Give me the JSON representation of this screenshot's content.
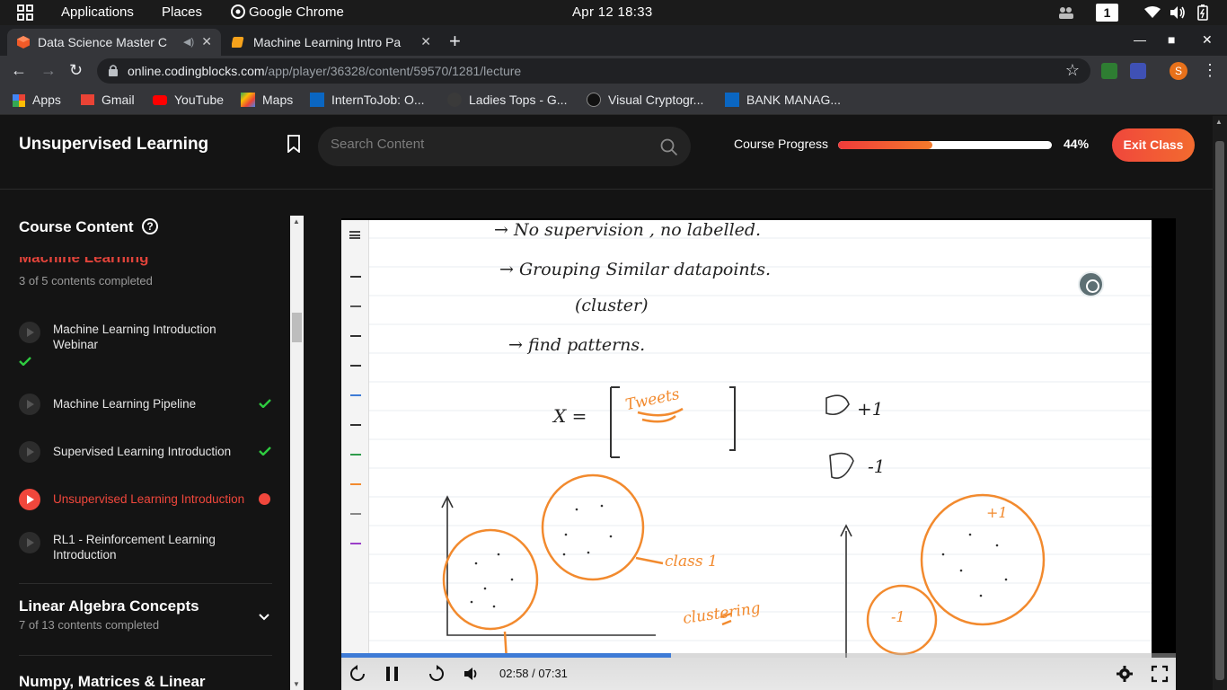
{
  "gnome": {
    "applications": "Applications",
    "places": "Places",
    "browser": "Google Chrome",
    "clock": "Apr 12  18:33",
    "workspace": "1"
  },
  "tabs": [
    {
      "title": "Data Science Master C",
      "active": true
    },
    {
      "title": "Machine Learning Intro Pa",
      "active": false
    }
  ],
  "address": {
    "host": "online.codingblocks.com",
    "path": "/app/player/36328/content/59570/1281/lecture"
  },
  "profile_initial": "S",
  "bookmarks": [
    "Apps",
    "Gmail",
    "YouTube",
    "Maps",
    "InternToJob: O...",
    "Ladies Tops - G...",
    "Visual Cryptogr...",
    "BANK MANAG..."
  ],
  "header": {
    "title": "Unsupervised Learning",
    "search_placeholder": "Search Content",
    "progress_label": "Course Progress",
    "progress_pct": "44%",
    "progress_value": 0.44,
    "exit_label": "Exit Class"
  },
  "sidebar": {
    "title": "Course Content",
    "help": "?",
    "current_section": {
      "name": "Machine Learning",
      "count": "3 of 5 contents completed",
      "lessons": [
        {
          "title": "Machine Learning Introduction Webinar",
          "done": true
        },
        {
          "title": "Machine Learning Pipeline",
          "done": true
        },
        {
          "title": "Supervised Learning Introduction",
          "done": true
        },
        {
          "title": "Unsupervised Learning Introduction",
          "current": true
        },
        {
          "title": "RL1 - Reinforcement Learning Introduction",
          "done": false
        }
      ]
    },
    "sections": [
      {
        "name": "Linear Algebra Concepts",
        "count": "7 of 13 contents completed"
      },
      {
        "name": "Numpy, Matrices & Linear",
        "count": ""
      }
    ]
  },
  "video": {
    "time": "02:58 / 07:31",
    "played_fraction": 0.395,
    "notes": {
      "line1": "→ No supervision , no labelled.",
      "line2": "→ Grouping Similar datapoints.",
      "line3": "(cluster)",
      "line4": "→ find patterns.",
      "eq_x": "X =",
      "eq_word": "Tweets",
      "plus1": "+1",
      "minus1": "-1",
      "class1": "class 1",
      "clustering": "clustering",
      "cluster_plus": "+1",
      "cluster_minus": "-1"
    }
  },
  "colors": {
    "accent": "#f0473c",
    "check": "#2ecc40",
    "ink_orange": "#f28a2e",
    "video_progress": "#3e7bd6"
  }
}
